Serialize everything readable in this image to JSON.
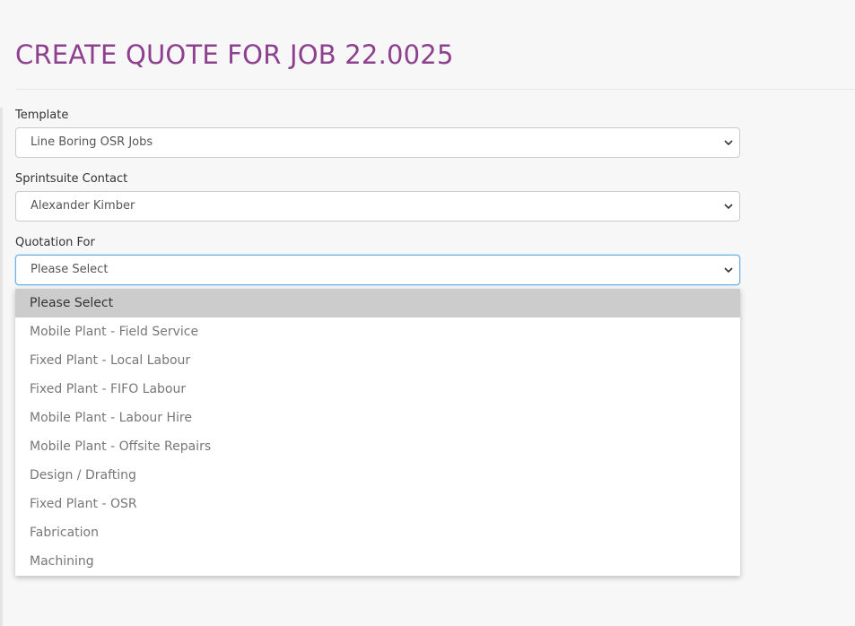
{
  "page": {
    "title": "CREATE QUOTE FOR JOB 22.0025"
  },
  "form": {
    "template": {
      "label": "Template",
      "value": "Line Boring OSR Jobs"
    },
    "contact": {
      "label": "Sprintsuite Contact",
      "value": "Alexander Kimber"
    },
    "quotation_for": {
      "label": "Quotation For",
      "value": "Please Select",
      "options": [
        "Please Select",
        "Mobile Plant - Field Service",
        "Fixed Plant - Local Labour",
        "Fixed Plant - FIFO Labour",
        "Mobile Plant - Labour Hire",
        "Mobile Plant - Offsite Repairs",
        "Design / Drafting",
        "Fixed Plant - OSR",
        "Fabrication",
        "Machining"
      ],
      "selected_index": 0
    }
  },
  "colors": {
    "title": "#8e3f8e",
    "focus_border": "#66afe9",
    "selected_option_bg": "#cccccc"
  },
  "icons": {
    "select_arrow": "chevron-down-icon"
  }
}
